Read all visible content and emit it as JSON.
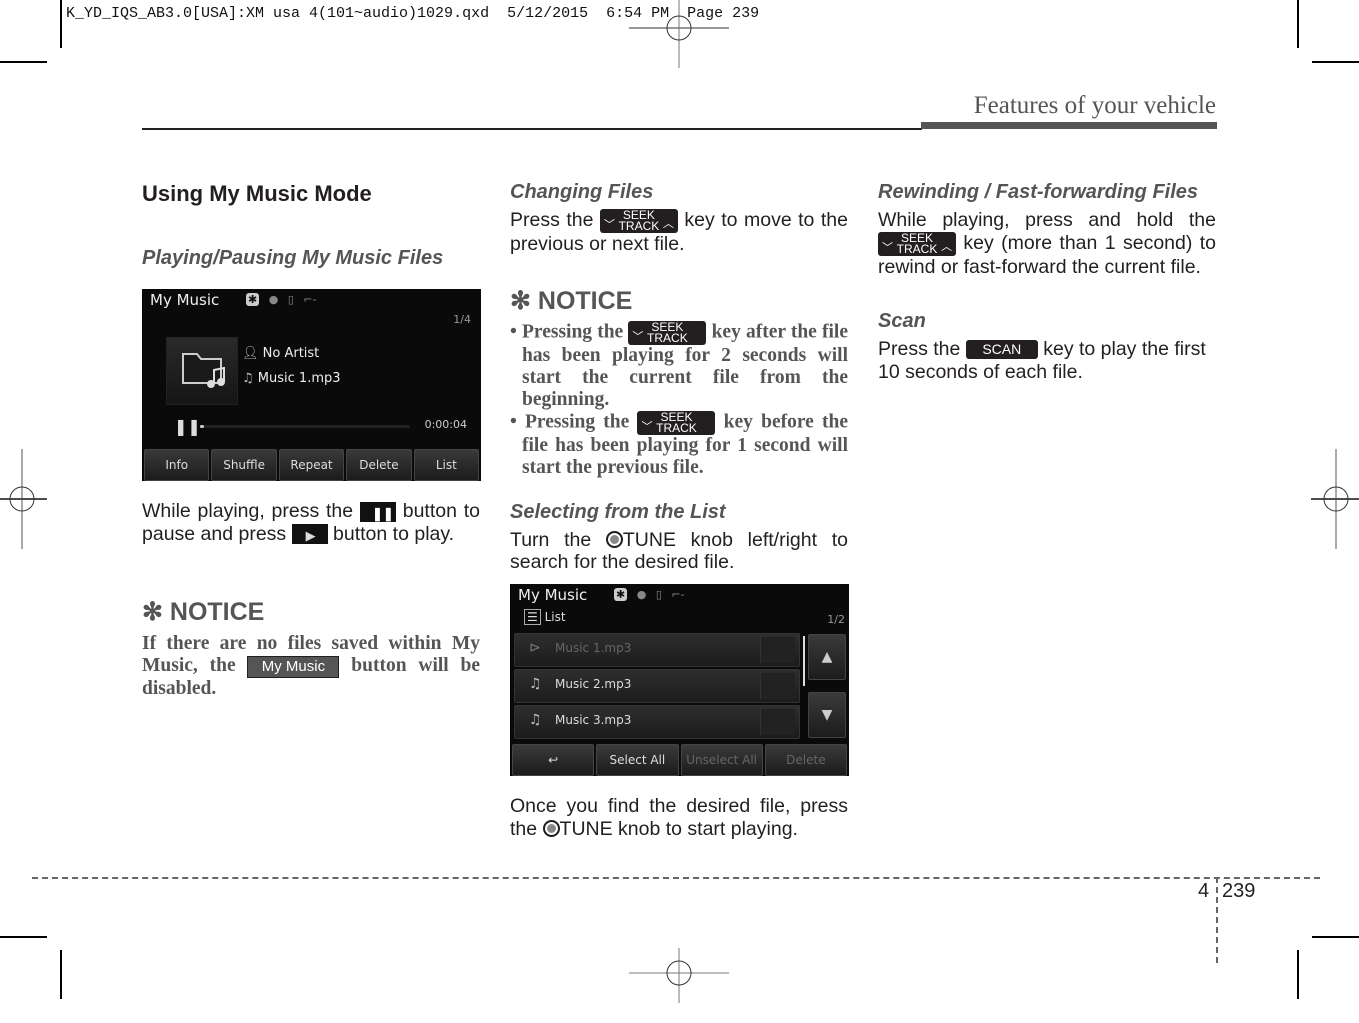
{
  "slug": "K_YD_IQS_AB3.0[USA]:XM usa 4(101~audio)1029.qxd  5/12/2015  6:54 PM  Page 239",
  "running_head": "Features of your vehicle",
  "page": {
    "chapter": "4",
    "number": "239"
  },
  "col1": {
    "title": "Using My Music Mode",
    "subtitle": "Playing/Pausing My Music Files",
    "screen": {
      "title": "My Music",
      "status_icons": [
        "bluetooth-icon",
        "disc-icon",
        "usb-icon",
        "aux-icon"
      ],
      "track_index": "1/4",
      "artist": "No Artist",
      "track": "Music 1.mp3",
      "elapsed": "0:00:04",
      "progress": 0.01,
      "buttons": [
        "Info",
        "Shuffle",
        "Repeat",
        "Delete",
        "List"
      ]
    },
    "para_a": "While playing, press the",
    "para_b": "button to pause and press",
    "para_c": "button to play.",
    "notice_heading": "✻ NOTICE",
    "notice_a": "If there are no files saved within My Music, the",
    "notice_key": "My Music",
    "notice_b": "button will be disabled."
  },
  "col2": {
    "h_changing": "Changing Files",
    "changing_a": "Press the",
    "changing_b": "key to move to the previous or next file.",
    "seek_label_1": "SEEK",
    "seek_label_2": "TRACK",
    "notice_heading": "✻ NOTICE",
    "bullet1_a": "• Pressing the",
    "bullet1_b": "key after the file has been playing for 2 seconds will start the current file from the beginning.",
    "bullet2_a": "• Pressing the",
    "bullet2_b": "key before the file has been playing for 1 second will start the previous file.",
    "h_selecting": "Selecting from the List",
    "select_a": "Turn the",
    "select_b": "TUNE knob left/right to search for the desired file.",
    "screen": {
      "title": "My Music",
      "list_label": "List",
      "page_index": "1/2",
      "rows": [
        "Music 1.mp3",
        "Music 2.mp3",
        "Music 3.mp3"
      ],
      "buttons": [
        "↩",
        "Select All",
        "Unselect All",
        "Delete"
      ]
    },
    "once_a": "Once you find the desired file, press the",
    "once_b": "TUNE knob to start playing."
  },
  "col3": {
    "h_rewind": "Rewinding / Fast-forwarding Files",
    "rewind_a": "While playing, press and hold the",
    "rewind_b": "key (more than 1 second) to rewind or fast-forward the current file.",
    "h_scan": "Scan",
    "scan_a": "Press the",
    "scan_key": "SCAN",
    "scan_b": "key to play the first 10 seconds of each file."
  }
}
